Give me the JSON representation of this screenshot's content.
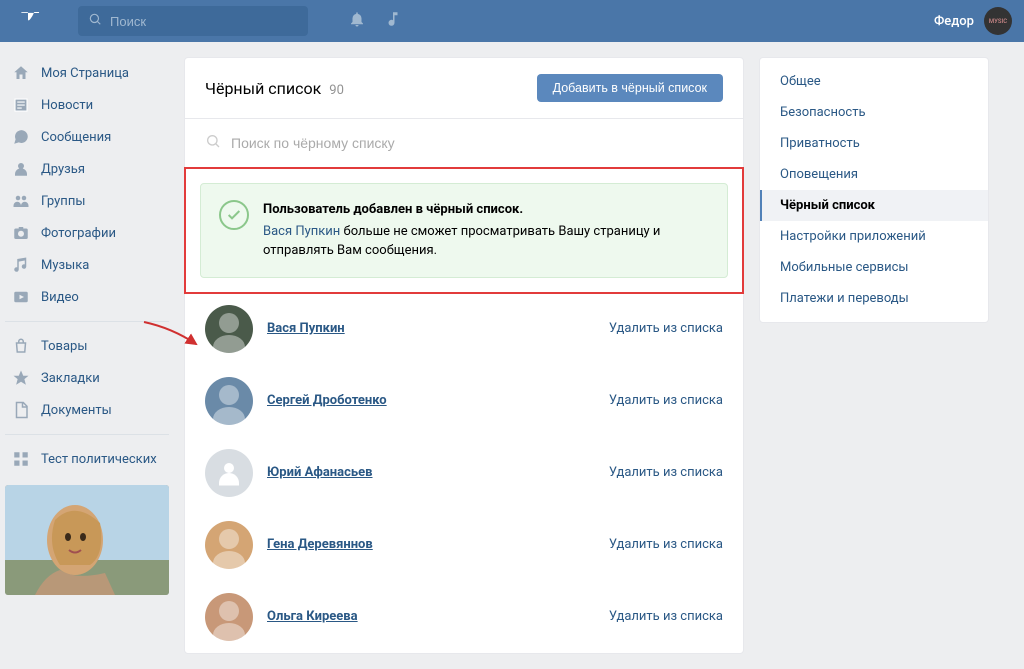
{
  "header": {
    "search_placeholder": "Поиск",
    "user_name": "Федор"
  },
  "left_nav": [
    {
      "label": "Моя Страница",
      "icon": "home"
    },
    {
      "label": "Новости",
      "icon": "news"
    },
    {
      "label": "Сообщения",
      "icon": "chat"
    },
    {
      "label": "Друзья",
      "icon": "friends"
    },
    {
      "label": "Группы",
      "icon": "groups"
    },
    {
      "label": "Фотографии",
      "icon": "photo"
    },
    {
      "label": "Музыка",
      "icon": "music"
    },
    {
      "label": "Видео",
      "icon": "video"
    }
  ],
  "left_nav_2": [
    {
      "label": "Товары",
      "icon": "bag"
    },
    {
      "label": "Закладки",
      "icon": "star"
    },
    {
      "label": "Документы",
      "icon": "doc"
    }
  ],
  "left_nav_3": [
    {
      "label": "Тест политических",
      "icon": "grid"
    }
  ],
  "blacklist": {
    "title": "Чёрный список",
    "count": "90",
    "add_button": "Добавить в чёрный список",
    "search_placeholder": "Поиск по чёрному списку",
    "notice_title": "Пользователь добавлен в чёрный список.",
    "notice_user": "Вася Пупкин",
    "notice_text": " больше не сможет просматривать Вашу страницу и отправлять Вам сообщения.",
    "remove_label": "Удалить из списка",
    "items": [
      {
        "name": "Вася Пупкин",
        "avatar_color": "#4a5a4a"
      },
      {
        "name": "Сергей Дроботенко",
        "avatar_color": "#6a8aa8"
      },
      {
        "name": "Юрий Афанасьев",
        "avatar_color": "grey"
      },
      {
        "name": "Гена Деревяннов",
        "avatar_color": "#d4a574"
      },
      {
        "name": "Ольга Киреева",
        "avatar_color": "#c89878"
      }
    ]
  },
  "settings_menu": [
    "Общее",
    "Безопасность",
    "Приватность",
    "Оповещения",
    "Чёрный список",
    "Настройки приложений",
    "Мобильные сервисы",
    "Платежи и переводы"
  ],
  "settings_active_index": 4
}
